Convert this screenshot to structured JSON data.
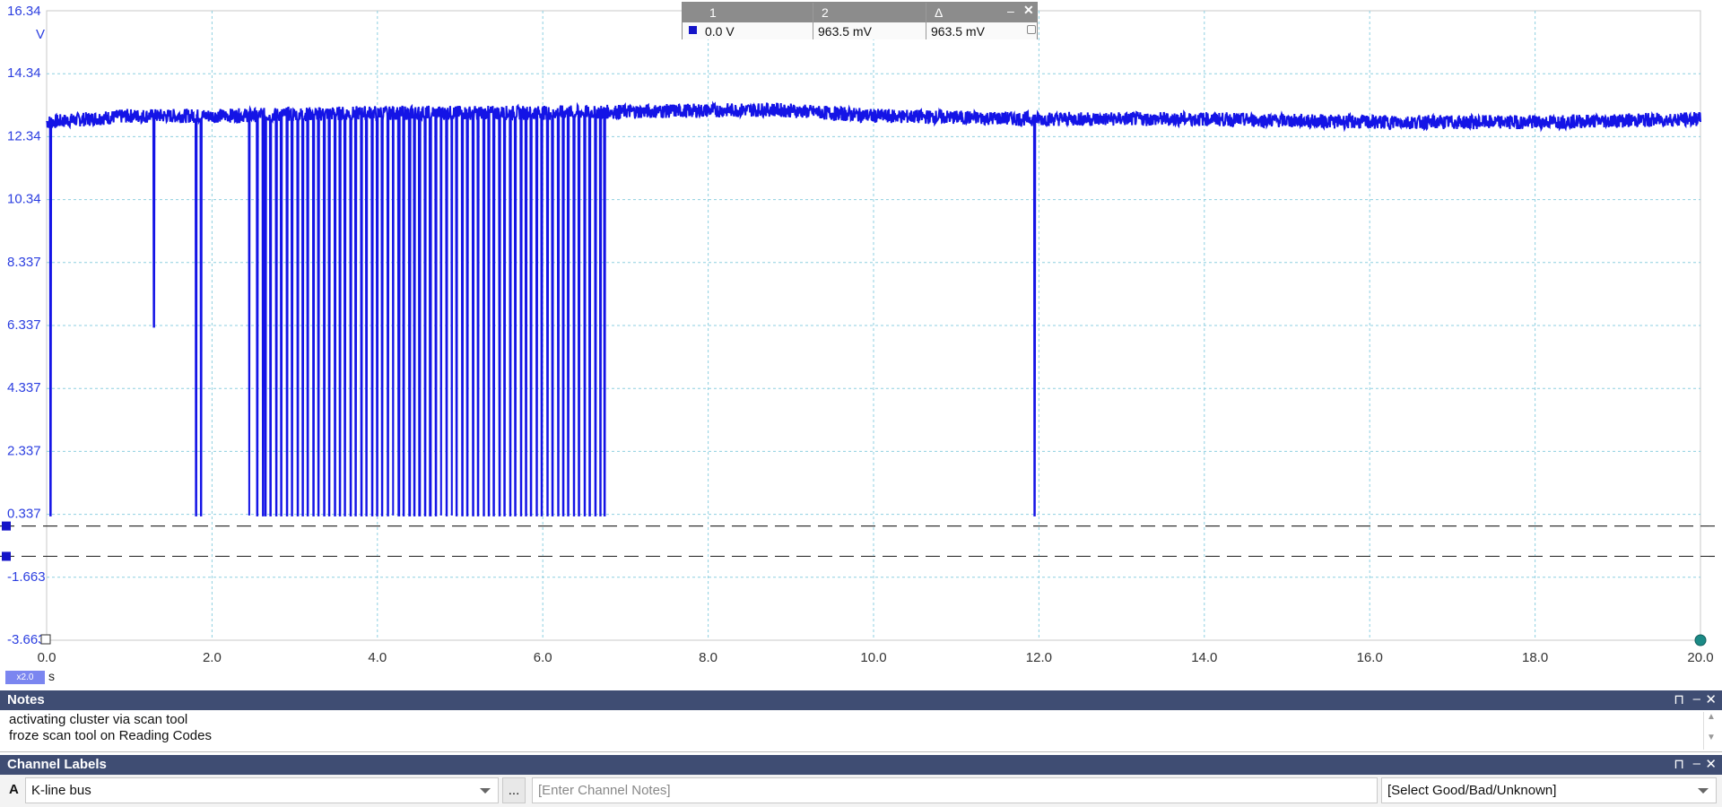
{
  "scope": {
    "y_unit": "V",
    "y_ticks": [
      "16.34",
      "14.34",
      "12.34",
      "10.34",
      "8.337",
      "6.337",
      "4.337",
      "2.337",
      "0.337",
      "-1.663",
      "-3.663"
    ],
    "x_ticks": [
      "0.0",
      "2.0",
      "4.0",
      "6.0",
      "8.0",
      "10.0",
      "12.0",
      "14.0",
      "16.0",
      "18.0",
      "20.0"
    ],
    "x_unit": "s",
    "zoom": "x2.0",
    "trace_color": "#1414e6",
    "grid_color": "#8ecfe0",
    "label_color": "#2b3ee0"
  },
  "chart_data": {
    "type": "line",
    "title": "",
    "xlabel": "s",
    "ylabel": "V",
    "xlim": [
      0,
      20
    ],
    "ylim": [
      -3.663,
      16.34
    ],
    "grid": true,
    "baseline_high_volts": [
      [
        0.0,
        12.8
      ],
      [
        1.0,
        13.0
      ],
      [
        2.0,
        13.0
      ],
      [
        4.0,
        13.1
      ],
      [
        6.0,
        13.1
      ],
      [
        8.8,
        13.2
      ],
      [
        10.0,
        13.0
      ],
      [
        12.0,
        12.9
      ],
      [
        14.0,
        12.9
      ],
      [
        16.0,
        12.8
      ],
      [
        18.0,
        12.8
      ],
      [
        20.0,
        12.9
      ]
    ],
    "low_level_volts": 0.3,
    "dropouts": {
      "isolated": [
        0.05,
        1.81,
        1.87,
        2.45,
        2.55,
        2.62,
        6.75,
        11.95
      ],
      "partial": [
        {
          "t": 1.3,
          "min_volts": 6.3
        }
      ],
      "burst": {
        "start": 2.65,
        "end": 6.7,
        "count": 64
      }
    },
    "rulers": {
      "ruler_1_volts": 0.0,
      "ruler_2_volts": 0.9635
    }
  },
  "ruler_table": {
    "col1": "1",
    "col2": "2",
    "col_delta": "Δ",
    "val1": "0.0 V",
    "val2": "963.5 mV",
    "delta": "963.5 mV"
  },
  "notes": {
    "title": "Notes",
    "lines": [
      "activating cluster via scan tool",
      "froze scan tool on Reading Codes"
    ]
  },
  "channel_labels": {
    "title": "Channel Labels",
    "channel": "A",
    "label": "K-line bus",
    "more_button": "...",
    "notes_placeholder": "[Enter Channel Notes]",
    "status_select": "[Select Good/Bad/Unknown]"
  },
  "panel_controls": {
    "pin": "⊓",
    "minimize": "‒",
    "close": "✕"
  }
}
